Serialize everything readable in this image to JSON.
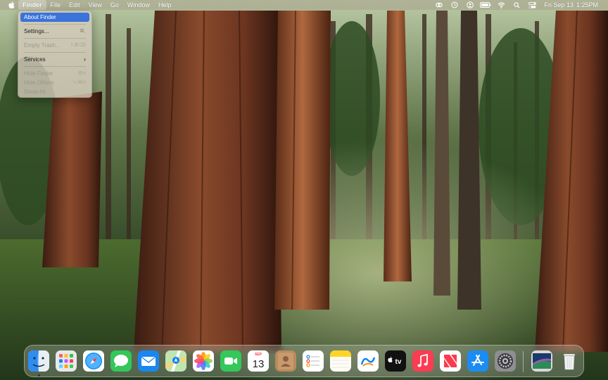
{
  "menubar": {
    "app_name": "Finder",
    "menus": [
      "File",
      "Edit",
      "View",
      "Go",
      "Window",
      "Help"
    ],
    "clock": {
      "date": "Fri Sep 13",
      "time": "1:25PM"
    }
  },
  "finder_menu": {
    "about": "About Finder",
    "settings": "Settings...",
    "settings_shortcut": "⌘,",
    "empty_trash": "Empty Trash...",
    "empty_trash_shortcut": "⇧⌘⌫",
    "services": "Services",
    "hide_finder": "Hide Finder",
    "hide_finder_shortcut": "⌘H",
    "hide_others": "Hide Others",
    "hide_others_shortcut": "⌥⌘H",
    "show_all": "Show All"
  },
  "dock": {
    "calendar_month": "SEP",
    "calendar_day": "13",
    "tv_label": "tv",
    "items": [
      "finder",
      "launchpad",
      "safari",
      "messages",
      "mail",
      "maps",
      "photos",
      "facetime",
      "calendar",
      "contacts",
      "reminders",
      "notes",
      "freeform",
      "tv",
      "music",
      "news",
      "app-store",
      "system-settings",
      "downloads",
      "trash"
    ]
  },
  "colors": {
    "menu_selection": "#3a73d9",
    "accent_red": "#fa3c4c"
  }
}
